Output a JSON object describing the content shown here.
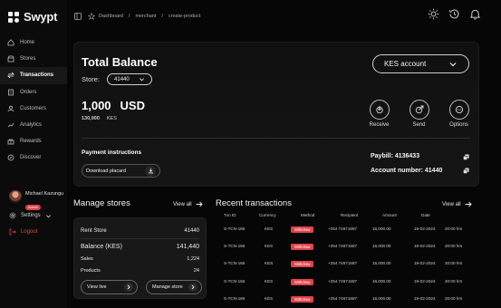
{
  "app": {
    "name": "Swypt"
  },
  "breadcrumb": [
    "Dashboard",
    "/",
    "merchant",
    "/",
    "create-product"
  ],
  "sidebar": {
    "items": [
      {
        "label": "Home",
        "icon": "home-icon",
        "active": false
      },
      {
        "label": "Stores",
        "icon": "store-icon",
        "active": false
      },
      {
        "label": "Transactions",
        "icon": "transactions-icon",
        "active": true
      },
      {
        "label": "Orders",
        "icon": "orders-icon",
        "active": false
      },
      {
        "label": "Customers",
        "icon": "customers-icon",
        "active": false
      },
      {
        "label": "Analytics",
        "icon": "analytics-icon",
        "active": false
      },
      {
        "label": "Rewards",
        "icon": "rewards-icon",
        "active": false
      },
      {
        "label": "Discover",
        "icon": "discover-icon",
        "active": false
      }
    ],
    "user": {
      "name": "Michael Kazungu",
      "role": "Admin"
    },
    "settings_label": "Settings",
    "logout_label": "Logout"
  },
  "balance": {
    "title": "Total Balance",
    "store_label": "Store:",
    "store_value": "41440",
    "account_select": "KES account",
    "amount": "1,000",
    "currency": "USD",
    "sub_amount": "130,000",
    "sub_currency": "KES",
    "actions": [
      {
        "label": "Receive",
        "icon": "receive-icon"
      },
      {
        "label": "Send",
        "icon": "send-icon"
      },
      {
        "label": "Options",
        "icon": "options-icon"
      }
    ],
    "payment_title": "Payment instructions",
    "download_label": "Download placard",
    "paybill": "Paybill: 4136433",
    "account_number": "Account number: 41440"
  },
  "manage_stores": {
    "title": "Manage stores",
    "view_all": "View all",
    "store_name": "Rent Store",
    "store_id": "41440",
    "balance_label": "Balance (KES)",
    "balance_value": "141,440",
    "sales_label": "Sales",
    "sales_value": "1,224",
    "products_label": "Products",
    "products_value": "24",
    "view_live": "View live",
    "manage_store": "Manage store"
  },
  "transactions": {
    "title": "Recent transactions",
    "view_all": "View all",
    "columns": [
      "Txn ID",
      "Currency",
      "Method",
      "Recipient",
      "Amount",
      "Date"
    ],
    "rows": [
      {
        "id": "S-TCN-166",
        "currency": "KES",
        "method": "Withdraw",
        "recipient": "+254 74671687",
        "amount": "16,000.00",
        "date": "19-02-2024",
        "time": "20:00 hrs"
      },
      {
        "id": "S-TCN-166",
        "currency": "KES",
        "method": "Withdraw",
        "recipient": "+254 74671687",
        "amount": "16,000.00",
        "date": "19-02-2024",
        "time": "20:00 hrs"
      },
      {
        "id": "S-TCN-166",
        "currency": "KES",
        "method": "Withdraw",
        "recipient": "+254 74671687",
        "amount": "16,000.00",
        "date": "19-02-2024",
        "time": "20:00 hrs"
      },
      {
        "id": "S-TCN-166",
        "currency": "KES",
        "method": "Withdraw",
        "recipient": "+254 74671687",
        "amount": "16,000.00",
        "date": "19-02-2024",
        "time": "20:00 hrs"
      },
      {
        "id": "S-TCN-166",
        "currency": "KES",
        "method": "Withdraw",
        "recipient": "+254 74671687",
        "amount": "16,000.00",
        "date": "19-02-2024",
        "time": "20:00 hrs"
      }
    ]
  },
  "colors": {
    "accent": "#e2424a",
    "background": "#060606",
    "card": "#121212"
  }
}
